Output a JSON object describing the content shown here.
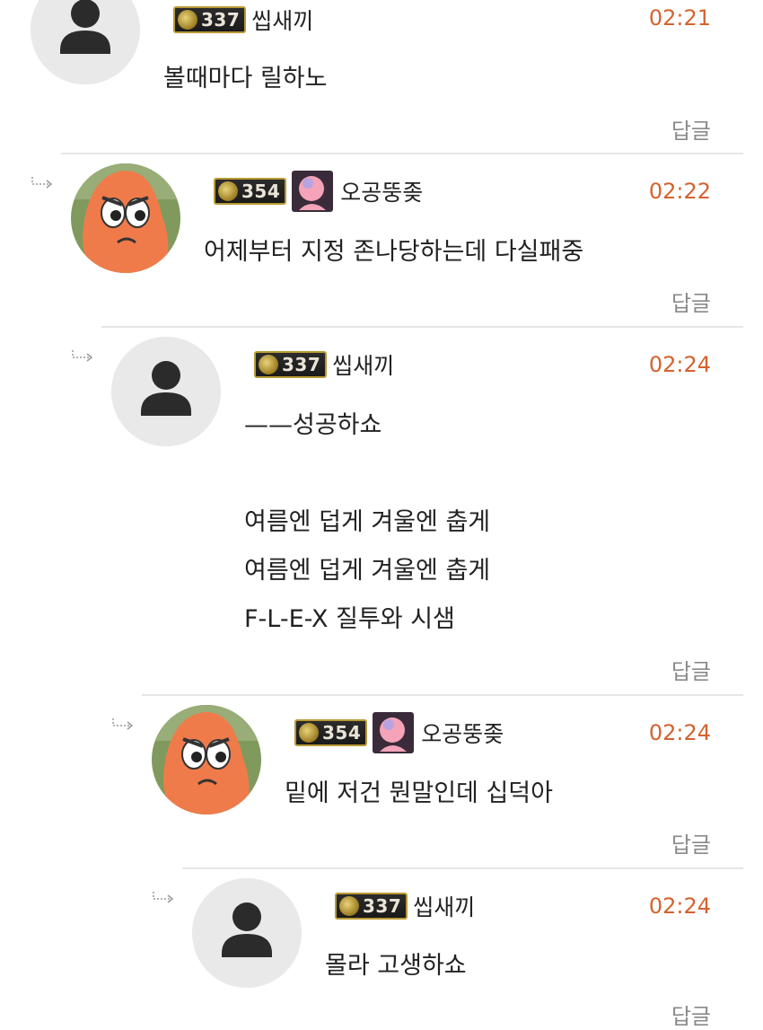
{
  "comments": [
    {
      "user": "씹새끼",
      "level": "337",
      "time": "02:21",
      "lines": [
        "볼때마다 릴하노"
      ],
      "reply_label": "답글",
      "avatar": "default-user-icon"
    },
    {
      "user": "오공뚱좆",
      "level": "354",
      "time": "02:22",
      "lines": [
        "어제부터 지정 존나당하는데 다실패중"
      ],
      "reply_label": "답글",
      "avatar": "starfish-cartoon-avatar"
    },
    {
      "user": "씹새끼",
      "level": "337",
      "time": "02:24",
      "lines": [
        "——성공하쇼",
        "",
        "여름엔 덥게 겨울엔 춥게",
        "여름엔 덥게 겨울엔 춥게",
        "F-L-E-X 질투와 시샘"
      ],
      "reply_label": "답글",
      "avatar": "default-user-icon"
    },
    {
      "user": "오공뚱좆",
      "level": "354",
      "time": "02:24",
      "lines": [
        "밑에 저건 뭔말인데 십덕아"
      ],
      "reply_label": "답글",
      "avatar": "starfish-cartoon-avatar"
    },
    {
      "user": "씹새끼",
      "level": "337",
      "time": "02:24",
      "lines": [
        "몰라 고생하쇼"
      ],
      "reply_label": "답글",
      "avatar": "default-user-icon"
    }
  ],
  "colors": {
    "time": "#d4622e",
    "reply": "#8a8a8a",
    "badge_border": "#b99a34"
  }
}
